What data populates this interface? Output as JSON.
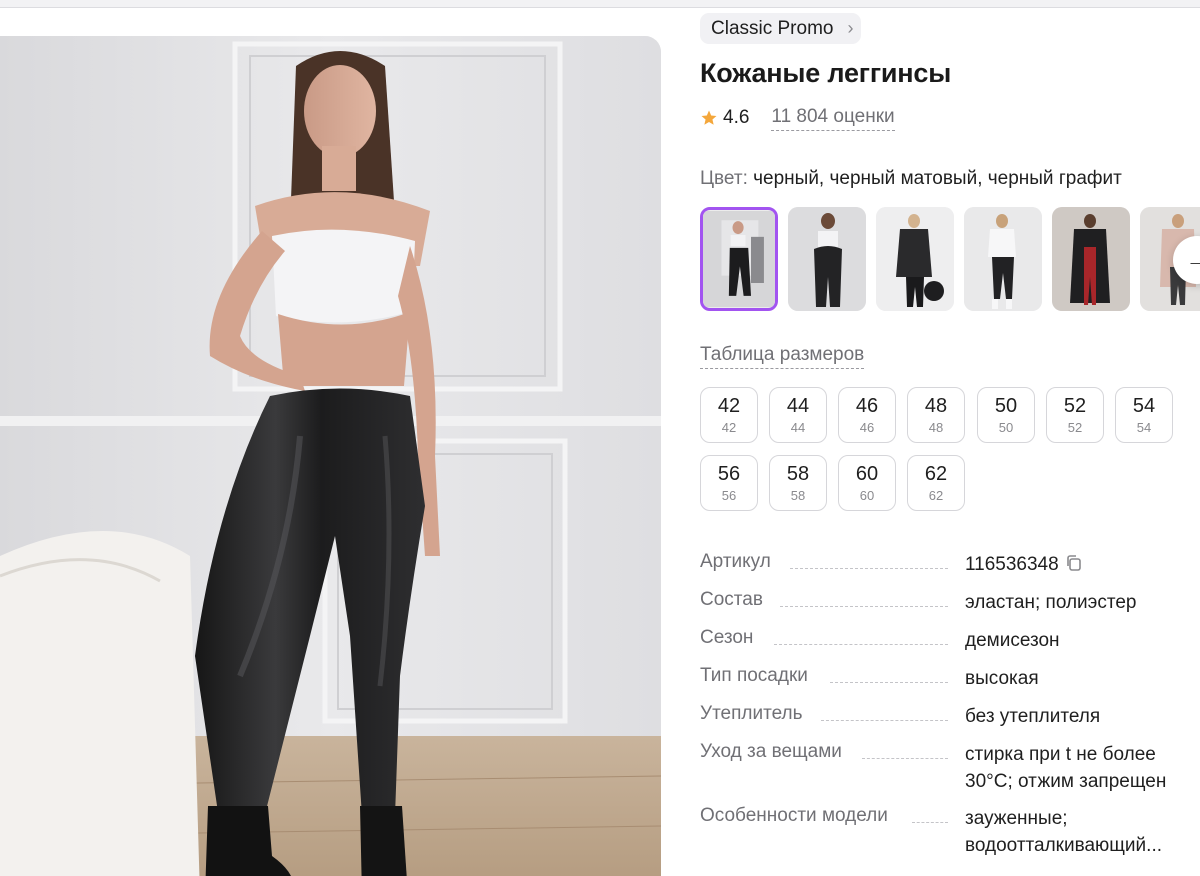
{
  "brand": {
    "name": "Classic Promo",
    "chevron": "›"
  },
  "product": {
    "title": "Кожаные леггинсы",
    "rating": "4.6",
    "reviews": "11 804 оценки"
  },
  "color": {
    "label": "Цвет:",
    "value": "черный, черный матовый, черный графит"
  },
  "swatch_icons": [
    "photo-thumbnail",
    "photo-thumbnail",
    "photo-thumbnail",
    "photo-thumbnail",
    "photo-thumbnail",
    "photo-thumbnail"
  ],
  "next_arrow": "→",
  "sizes": {
    "table_link": "Таблица размеров",
    "items": [
      {
        "size": "42",
        "ru": "42"
      },
      {
        "size": "44",
        "ru": "44"
      },
      {
        "size": "46",
        "ru": "46"
      },
      {
        "size": "48",
        "ru": "48"
      },
      {
        "size": "50",
        "ru": "50"
      },
      {
        "size": "52",
        "ru": "52"
      },
      {
        "size": "54",
        "ru": "54"
      },
      {
        "size": "56",
        "ru": "56"
      },
      {
        "size": "58",
        "ru": "58"
      },
      {
        "size": "60",
        "ru": "60"
      },
      {
        "size": "62",
        "ru": "62"
      }
    ]
  },
  "specs": [
    {
      "label": "Артикул",
      "value": "116536348"
    },
    {
      "label": "Состав",
      "value": "эластан; полиэстер"
    },
    {
      "label": "Сезон",
      "value": "демисезон"
    },
    {
      "label": "Тип посадки",
      "value": "высокая"
    },
    {
      "label": "Утеплитель",
      "value": "без утеплителя"
    },
    {
      "label": "Уход за вещами",
      "value": "стирка при t не более 30°С; отжим запрещен"
    },
    {
      "label": "Особенности модели",
      "value": "зауженные; водоотталкивающий..."
    }
  ],
  "colors": {
    "accent": "#a254f0",
    "star": "#f4a73b",
    "muted_text": "#707075",
    "border": "#d6d6da"
  }
}
